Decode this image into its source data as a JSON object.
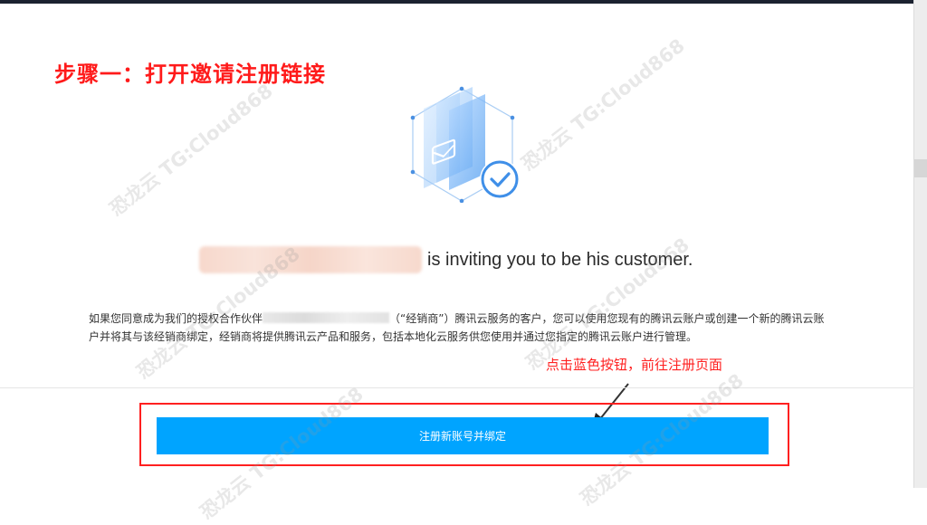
{
  "step_title": "步骤一：打开邀请注册链接",
  "invite": {
    "text": "is inviting you to be his customer."
  },
  "description": {
    "line1_before": "如果您同意成为我们的授权合作伙伴",
    "line1_after": "（“经销商”）腾讯云服务的客户，您可以使用您现有的腾讯云账户或创建一个新的腾讯云账",
    "line2": "户并将其与该经销商绑定，经销商将提供腾讯云产品和服务，包括本地化云服务供您使用并通过您指定的腾讯云账户进行管理。"
  },
  "annotation": "点击蓝色按钮，前往注册页面",
  "register_button": "注册新账号并绑定",
  "watermarks": [
    "恐龙云 TG:Cloud868",
    "恐龙云 TG:Cloud868",
    "恐龙云 TG:Cloud868",
    "恐龙云 TG:Cloud868",
    "恐龙云 TG:Cloud868",
    "恐龙云 TG:Cloud868"
  ],
  "colors": {
    "accent_red": "#ff1a1a",
    "button_blue": "#00a4ff",
    "logo_blue": "#4a90e2"
  },
  "icons": [
    "mail-check-logo-icon",
    "arrow-icon"
  ]
}
